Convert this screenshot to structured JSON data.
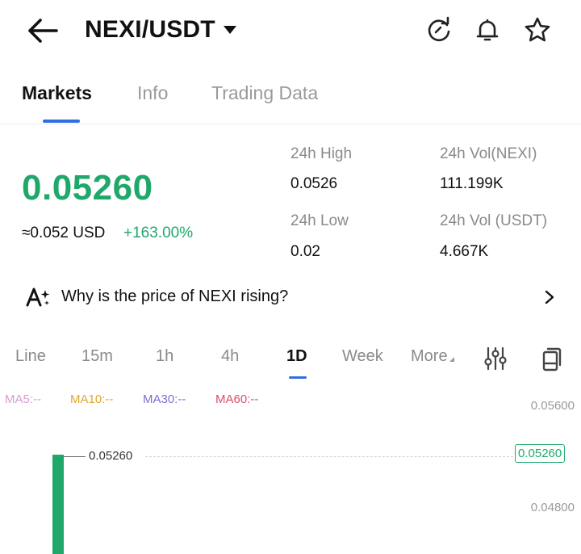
{
  "header": {
    "pair": "NEXI/USDT",
    "icons": [
      "back-arrow-icon",
      "refresh-icon",
      "bell-icon",
      "star-icon"
    ]
  },
  "tabs": [
    {
      "label": "Markets",
      "active": true
    },
    {
      "label": "Info",
      "active": false
    },
    {
      "label": "Trading Data",
      "active": false
    }
  ],
  "ticker": {
    "last_price": "0.05260",
    "approx_usd": "≈0.052 USD",
    "change_pct": "+163.00%",
    "high_label": "24h High",
    "high_value": "0.0526",
    "low_label": "24h Low",
    "low_value": "0.02",
    "vol_base_label": "24h Vol(NEXI)",
    "vol_base_value": "111.199K",
    "vol_quote_label": "24h Vol (USDT)",
    "vol_quote_value": "4.667K"
  },
  "insight": {
    "text": "Why is the price of NEXI rising?"
  },
  "intervals": {
    "items": [
      "Line",
      "15m",
      "1h",
      "4h",
      "1D",
      "Week",
      "More"
    ],
    "selected": "1D"
  },
  "chart": {
    "ma5": "MA5:--",
    "ma10": "MA10:--",
    "ma30": "MA30:--",
    "ma60": "MA60:--",
    "axis_top": "0.05600",
    "axis_mid": "0.04800",
    "last_price_label": "0.05260",
    "last_price_tag": "0.05260"
  },
  "colors": {
    "up": "#20a86b",
    "accent": "#2f6fe4",
    "ma5": "#d89bd0",
    "ma10": "#e3a52f",
    "ma30": "#7b6fd6",
    "ma60": "#d9506a"
  }
}
